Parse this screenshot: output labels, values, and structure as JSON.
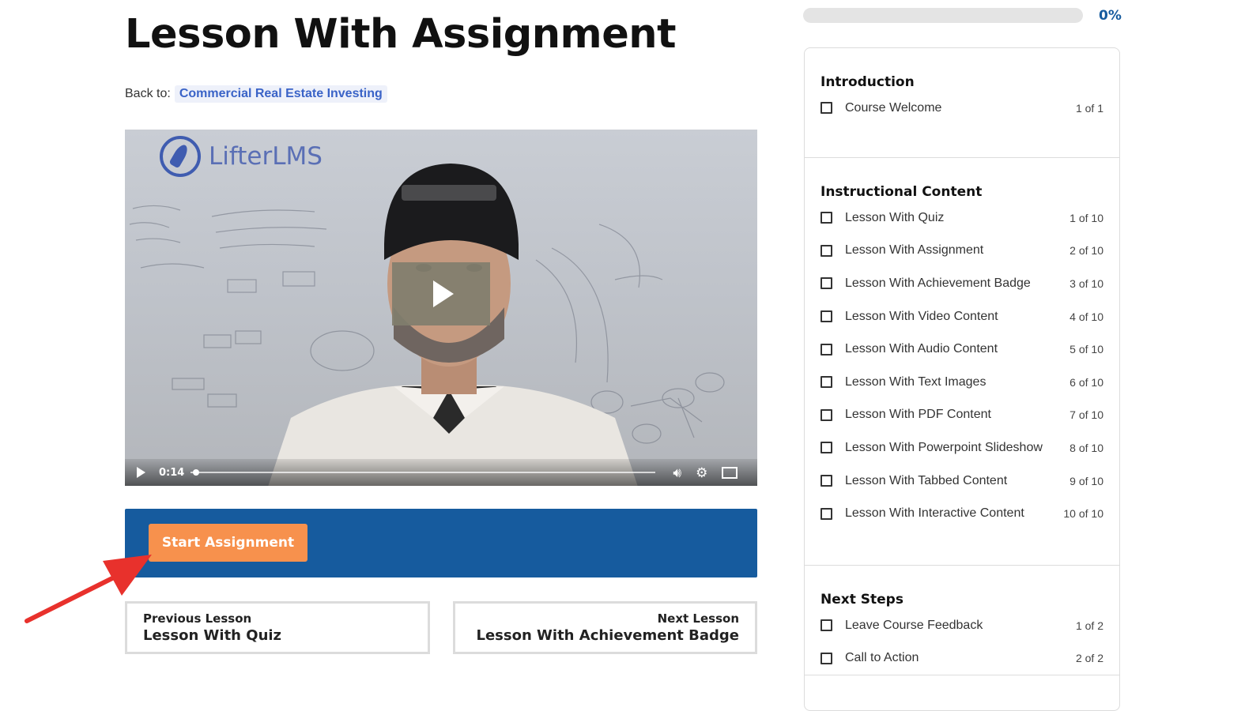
{
  "page": {
    "title": "Lesson With Assignment",
    "back_label": "Back to:",
    "back_link": "Commercial Real Estate Investing"
  },
  "video": {
    "logo_text": "LifterLMS",
    "time": "0:14",
    "progress_fraction": 0.005
  },
  "assignment": {
    "button_label": "Start Assignment"
  },
  "nav": {
    "prev_label": "Previous Lesson",
    "prev_title": "Lesson With Quiz",
    "next_label": "Next Lesson",
    "next_title": "Lesson With Achievement Badge"
  },
  "progress": {
    "label": "0%",
    "value": 0
  },
  "syllabus": {
    "sections": [
      {
        "title": "Introduction",
        "lessons": [
          {
            "name": "Course Welcome",
            "count": "1 of 1"
          }
        ]
      },
      {
        "title": "Instructional Content",
        "lessons": [
          {
            "name": "Lesson With Quiz",
            "count": "1 of 10"
          },
          {
            "name": "Lesson With Assignment",
            "count": "2 of 10"
          },
          {
            "name": "Lesson With Achievement Badge",
            "count": "3 of 10"
          },
          {
            "name": "Lesson With Video Content",
            "count": "4 of 10"
          },
          {
            "name": "Lesson With Audio Content",
            "count": "5 of 10"
          },
          {
            "name": "Lesson With Text Images",
            "count": "6 of 10"
          },
          {
            "name": "Lesson With PDF Content",
            "count": "7 of 10"
          },
          {
            "name": "Lesson With Powerpoint Slideshow",
            "count": "8 of 10"
          },
          {
            "name": "Lesson With Tabbed Content",
            "count": "9 of 10"
          },
          {
            "name": "Lesson With Interactive Content",
            "count": "10 of 10"
          }
        ]
      },
      {
        "title": "Next Steps",
        "lessons": [
          {
            "name": "Leave Course Feedback",
            "count": "1 of 2"
          },
          {
            "name": "Call to Action",
            "count": "2 of 2"
          }
        ]
      }
    ]
  },
  "colors": {
    "accent": "#165b9e",
    "button": "#f7914d",
    "link": "#3a63c7",
    "annotation_arrow": "#e8312c"
  }
}
